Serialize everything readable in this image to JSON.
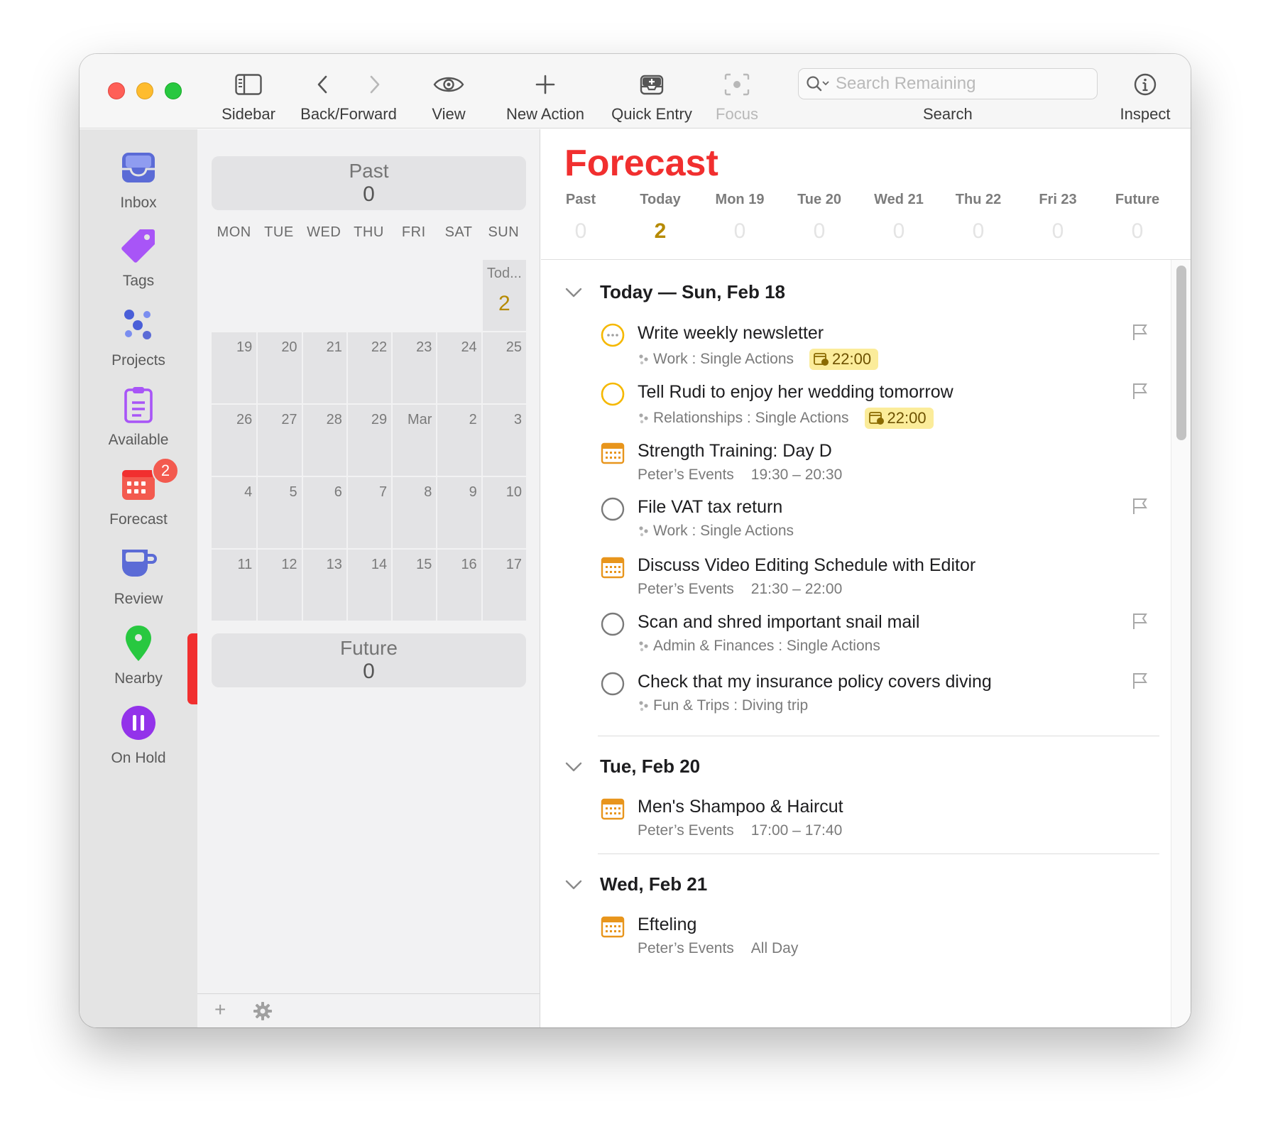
{
  "toolbar": {
    "sidebar": "Sidebar",
    "back_forward": "Back/Forward",
    "view": "View",
    "new_action": "New Action",
    "quick_entry": "Quick Entry",
    "focus": "Focus",
    "search_placeholder": "Search Remaining",
    "search": "Search",
    "inspect": "Inspect"
  },
  "sidebar": {
    "items": [
      {
        "label": "Inbox",
        "icon": "inbox-icon",
        "color": "#5b6bd6"
      },
      {
        "label": "Tags",
        "icon": "tag-icon",
        "color": "#a855f7"
      },
      {
        "label": "Projects",
        "icon": "projects-icon",
        "color": "#4a5fd8"
      },
      {
        "label": "Available",
        "icon": "clipboard-icon",
        "color": "#a855f7"
      },
      {
        "label": "Forecast",
        "icon": "calendar-icon",
        "color": "#f12f2f",
        "badge": "2"
      },
      {
        "label": "Review",
        "icon": "cup-icon",
        "color": "#5b6bd6"
      },
      {
        "label": "Nearby",
        "icon": "location-pin-icon",
        "color": "#28c840"
      },
      {
        "label": "On Hold",
        "icon": "pause-icon",
        "color": "#9333ea"
      }
    ],
    "active": "Forecast"
  },
  "calendar": {
    "past": {
      "title": "Past",
      "count": "0"
    },
    "future": {
      "title": "Future",
      "count": "0"
    },
    "weekdays": [
      "MON",
      "TUE",
      "WED",
      "THU",
      "FRI",
      "SAT",
      "SUN"
    ],
    "today": {
      "name": "Tod...",
      "count": "2"
    },
    "weeks": [
      [
        "19",
        "20",
        "21",
        "22",
        "23",
        "24",
        "25"
      ],
      [
        "26",
        "27",
        "28",
        "29",
        "Mar",
        "2",
        "3"
      ],
      [
        "4",
        "5",
        "6",
        "7",
        "8",
        "9",
        "10"
      ],
      [
        "11",
        "12",
        "13",
        "14",
        "15",
        "16",
        "17"
      ]
    ],
    "add": "+"
  },
  "main": {
    "title": "Forecast",
    "title_color": "#f12f2f",
    "tabs": [
      {
        "label": "Past",
        "count": "0"
      },
      {
        "label": "Today",
        "count": "2",
        "active": true
      },
      {
        "label": "Mon 19",
        "count": "0"
      },
      {
        "label": "Tue 20",
        "count": "0"
      },
      {
        "label": "Wed 21",
        "count": "0"
      },
      {
        "label": "Thu 22",
        "count": "0"
      },
      {
        "label": "Fri 23",
        "count": "0"
      },
      {
        "label": "Future",
        "count": "0"
      }
    ],
    "sections": [
      {
        "title": "Today — Sun, Feb 18",
        "items": [
          {
            "title": "Write weekly newsletter",
            "kind": "action-due",
            "project": "Work : Single Actions",
            "due": "22:00",
            "flag": true
          },
          {
            "title": "Tell Rudi to enjoy her wedding tomorrow",
            "kind": "action-due-soon",
            "project": "Relationships : Single Actions",
            "due": "22:00",
            "flag": true
          },
          {
            "title": "Strength Training: Day D",
            "kind": "event",
            "calendar": "Peter’s Events",
            "time": "19:30 – 20:30"
          },
          {
            "title": "File VAT tax return",
            "kind": "action",
            "project": "Work : Single Actions",
            "flag": true
          },
          {
            "title": "Discuss Video Editing Schedule with Editor",
            "kind": "event",
            "calendar": "Peter’s Events",
            "time": "21:30 – 22:00"
          },
          {
            "title": "Scan and shred important snail mail",
            "kind": "action",
            "project": "Admin & Finances : Single Actions",
            "flag": true
          },
          {
            "title": "Check that my insurance policy covers diving",
            "kind": "action",
            "project": "Fun & Trips : Diving trip",
            "flag": true
          }
        ]
      },
      {
        "title": "Tue, Feb 20",
        "items": [
          {
            "title": "Men's Shampoo & Haircut",
            "kind": "event",
            "calendar": "Peter’s Events",
            "time": "17:00 – 17:40"
          }
        ]
      },
      {
        "title": "Wed, Feb 21",
        "items": [
          {
            "title": "Efteling",
            "kind": "event",
            "calendar": "Peter’s Events",
            "time": "All Day"
          }
        ]
      }
    ]
  }
}
